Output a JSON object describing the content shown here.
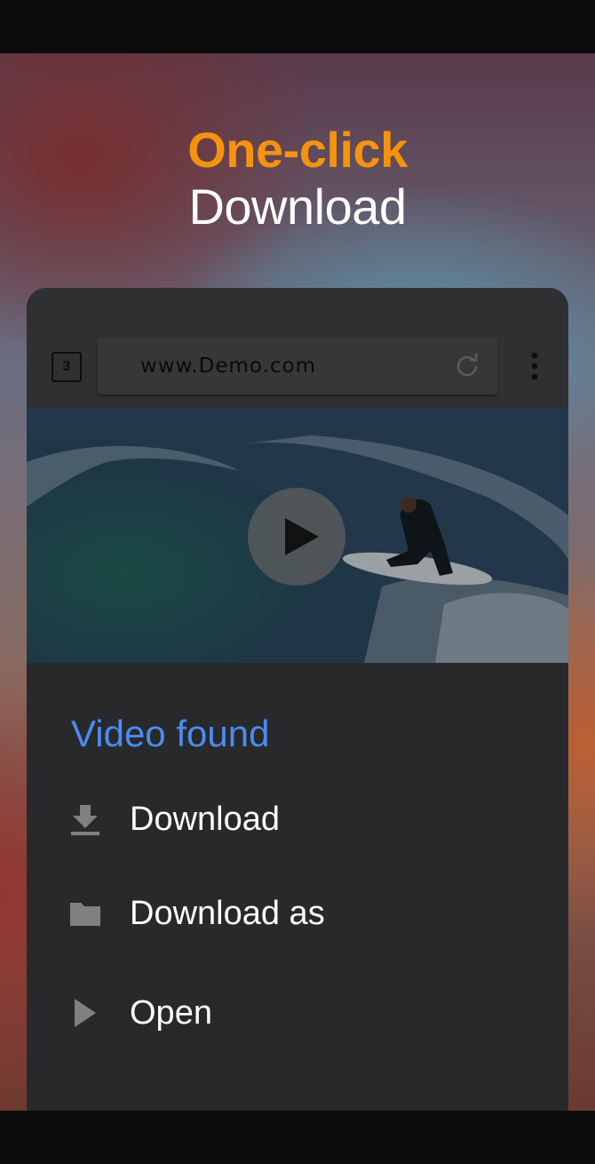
{
  "headline": {
    "accent": "One-click",
    "main": "Download"
  },
  "browser": {
    "tab_count": "3",
    "url": "www.Demo.com",
    "icons": [
      "reload-icon",
      "more-vert-icon"
    ]
  },
  "video": {
    "overlay_icon": "play-icon"
  },
  "sheet": {
    "title": "Video found",
    "actions": [
      {
        "label": "Download",
        "icon": "download-icon"
      },
      {
        "label": "Download as",
        "icon": "folder-icon"
      },
      {
        "label": "Open",
        "icon": "play-arrow-icon"
      }
    ]
  },
  "colors": {
    "accent": "#f5930e",
    "link_blue": "#4c8bf0",
    "sheet_bg": "#28292b"
  }
}
